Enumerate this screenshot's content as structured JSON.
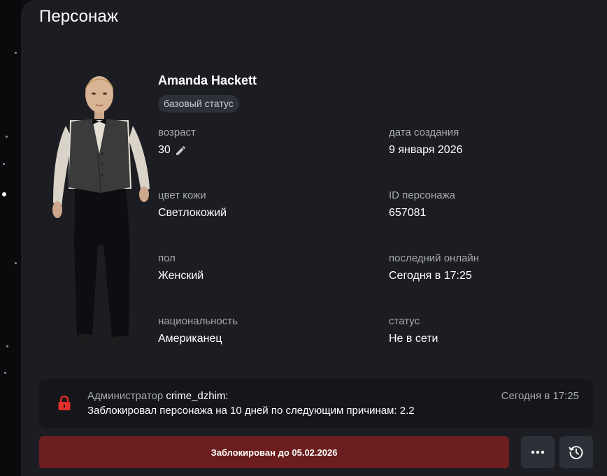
{
  "section_title": "Персонаж",
  "character": {
    "name": "Amanda Hackett",
    "status_chip": "базовый статус",
    "fields": {
      "age": {
        "label": "возраст",
        "value": "30"
      },
      "created": {
        "label": "дата создания",
        "value": "9 января 2026"
      },
      "skin": {
        "label": "цвет кожи",
        "value": "Светлокожий"
      },
      "id": {
        "label": "ID персонажа",
        "value": "657081"
      },
      "gender": {
        "label": "пол",
        "value": "Женский"
      },
      "last_online": {
        "label": "последний онлайн",
        "value": "Сегодня в 17:25"
      },
      "nationality": {
        "label": "национальность",
        "value": "Американец"
      },
      "status": {
        "label": "статус",
        "value": "Не в сети"
      }
    }
  },
  "log": {
    "prefix": "Администратор",
    "admin": "crime_dzhim:",
    "message": "Заблокировал персонажа на 10 дней по следующим причинам: 2.2",
    "time": "Сегодня в 17:25"
  },
  "actions": {
    "ban_label": "Заблокирован до 05.02.2026",
    "more_icon": "more-dots-icon",
    "history_icon": "history-clock-icon"
  },
  "colors": {
    "background": "#1c1d22",
    "ban_button": "#6b1e1d",
    "lock_icon": "#e0302a",
    "muted_text": "#a7a9b0"
  }
}
